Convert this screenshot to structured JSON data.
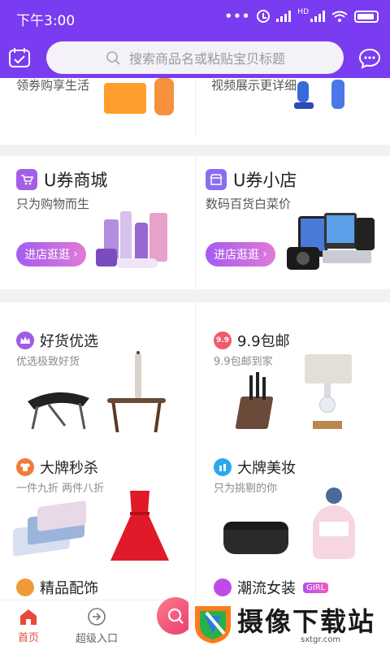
{
  "status_bar": {
    "time": "下午3:00",
    "network_label": "HD"
  },
  "header": {
    "search_placeholder": "搜索商品名或粘贴宝贝标题"
  },
  "top_row_cut": {
    "left_text": "领劵购享生活",
    "right_text": "视频展示更详细"
  },
  "stores": [
    {
      "title": "U券商城",
      "subtitle": "只为购物而生",
      "button": "进店逛逛"
    },
    {
      "title": "U券小店",
      "subtitle": "数码百货白菜价",
      "button": "进店逛逛"
    }
  ],
  "sections": [
    {
      "title": "好货优选",
      "subtitle": "优选极致好货",
      "icon": "crown-icon",
      "color": "#a05ae8"
    },
    {
      "title": "9.9包邮",
      "subtitle": "9.9包邮到家",
      "icon": "nine-nine-icon",
      "color": "#f05a6a",
      "badge": "9.9"
    },
    {
      "title": "大牌秒杀",
      "subtitle": "一件九折  两件八折",
      "icon": "shirt-icon",
      "color": "#f07a3a"
    },
    {
      "title": "大牌美妆",
      "subtitle": "只为挑剔的你",
      "icon": "cosmetics-icon",
      "color": "#2aa8f0"
    },
    {
      "title": "精品配饰",
      "icon": "accessory-icon",
      "color": "#f09a3a"
    },
    {
      "title": "潮流女装",
      "icon": "dress-icon",
      "color": "#c04ae8",
      "tag": "GIRL"
    }
  ],
  "bottom_nav": {
    "home": "首页",
    "super": "超级入口"
  },
  "watermark": {
    "brand": "摄像下载站",
    "url": "sxtgr.com"
  },
  "colors": {
    "primary": "#7a3cf0",
    "accent_red": "#e8483d"
  }
}
